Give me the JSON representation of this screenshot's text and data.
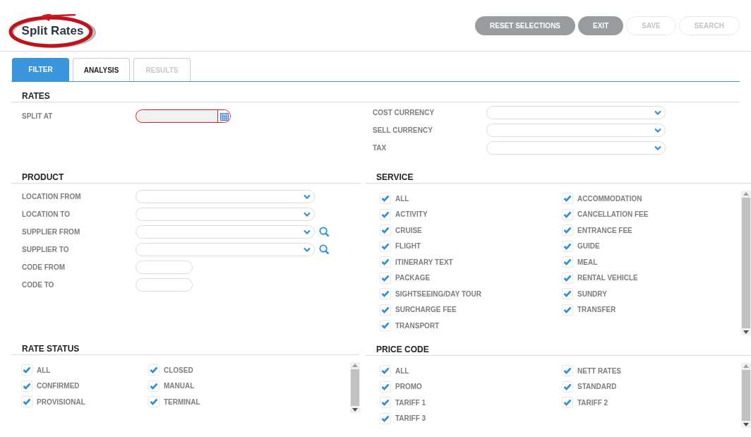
{
  "title": "Split Rates",
  "buttons": [
    {
      "label": "RESET SELECTIONS",
      "disabled": false
    },
    {
      "label": "EXIT",
      "disabled": false
    },
    {
      "label": "SAVE",
      "disabled": true
    },
    {
      "label": "SEARCH",
      "disabled": true
    }
  ],
  "tabs": [
    {
      "label": "FILTER",
      "selected": true,
      "disabled": false
    },
    {
      "label": "ANALYSIS",
      "selected": false,
      "disabled": false
    },
    {
      "label": "RESULTS",
      "selected": false,
      "disabled": true
    }
  ],
  "rates": {
    "title": "RATES",
    "left_fields": [
      {
        "label": "SPLIT AT",
        "kind": "date"
      }
    ],
    "right_fields": [
      {
        "label": "COST CURRENCY",
        "kind": "select"
      },
      {
        "label": "SELL CURRENCY",
        "kind": "select"
      },
      {
        "label": "TAX",
        "kind": "select"
      }
    ]
  },
  "product": {
    "title": "PRODUCT",
    "fields": [
      {
        "label": "LOCATION FROM",
        "kind": "select"
      },
      {
        "label": "LOCATION TO",
        "kind": "select"
      },
      {
        "label": "SUPPLIER FROM",
        "kind": "search"
      },
      {
        "label": "SUPPLIER TO",
        "kind": "search"
      },
      {
        "label": "CODE FROM",
        "kind": "text"
      },
      {
        "label": "CODE TO",
        "kind": "text"
      }
    ]
  },
  "service": {
    "title": "SERVICE",
    "items": [
      {
        "label": "ALL",
        "checked": true
      },
      {
        "label": "ACCOMMODATION",
        "checked": true
      },
      {
        "label": "ACTIVITY",
        "checked": true
      },
      {
        "label": "CANCELLATION FEE",
        "checked": true
      },
      {
        "label": "CRUISE",
        "checked": true
      },
      {
        "label": "ENTRANCE FEE",
        "checked": true
      },
      {
        "label": "FLIGHT",
        "checked": true
      },
      {
        "label": "GUIDE",
        "checked": true
      },
      {
        "label": "ITINERARY TEXT",
        "checked": true
      },
      {
        "label": "MEAL",
        "checked": true
      },
      {
        "label": "PACKAGE",
        "checked": true
      },
      {
        "label": "RENTAL VEHICLE",
        "checked": true
      },
      {
        "label": "SIGHTSEEING/DAY TOUR",
        "checked": true
      },
      {
        "label": "SUNDRY",
        "checked": true
      },
      {
        "label": "SURCHARGE FEE",
        "checked": true
      },
      {
        "label": "TRANSFER",
        "checked": true
      },
      {
        "label": "TRANSPORT",
        "checked": true
      }
    ]
  },
  "rate_status": {
    "title": "RATE STATUS",
    "items": [
      {
        "label": "ALL",
        "checked": true
      },
      {
        "label": "CLOSED",
        "checked": true
      },
      {
        "label": "CONFIRMED",
        "checked": true
      },
      {
        "label": "MANUAL",
        "checked": true
      },
      {
        "label": "PROVISIONAL",
        "checked": true
      },
      {
        "label": "TERMINAL",
        "checked": true
      }
    ]
  },
  "price_code": {
    "title": "PRICE CODE",
    "items": [
      {
        "label": "ALL",
        "checked": true
      },
      {
        "label": "NETT RATES",
        "checked": true
      },
      {
        "label": "PROMO",
        "checked": true
      },
      {
        "label": "STANDARD",
        "checked": true
      },
      {
        "label": "TARIFF 1",
        "checked": true
      },
      {
        "label": "TARIFF 2",
        "checked": true
      },
      {
        "label": "TARIFF 3",
        "checked": true
      }
    ]
  }
}
